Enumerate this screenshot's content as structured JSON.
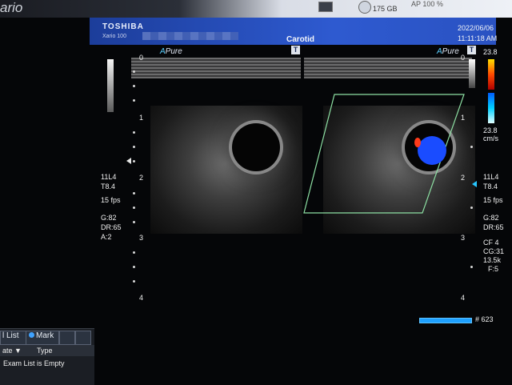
{
  "window": {
    "title_fragment": "ario"
  },
  "top_status": {
    "drive_label": "175 GB",
    "right_text": "AP 100 %"
  },
  "header": {
    "brand": "TOSHIBA",
    "model": "Xario 100",
    "preset": "Carotid",
    "date": "2022/06/06",
    "time": "11:11:18 AM"
  },
  "modes": {
    "left_pure": "Pure",
    "right_pure": "Pure",
    "freeze_icon_label": "T"
  },
  "left_params": {
    "probe": "11L4",
    "freq": "T8.4",
    "fps": "15 fps",
    "gain": "G:82",
    "dr": "DR:65",
    "a": "A:2"
  },
  "right_params": {
    "probe": "11L4",
    "freq": "T8.4",
    "fps": "15 fps",
    "gain": "G:82",
    "dr": "DR:65",
    "cf": "CF 4",
    "cg": "CG:31",
    "prf": "13.5k",
    "f": "F:5"
  },
  "color_scale": {
    "top": "23.8",
    "bottom": "23.8",
    "unit": "cm/s"
  },
  "depth_marks": [
    "0",
    "1",
    "2",
    "3",
    "4"
  ],
  "frame": {
    "number": "# 623"
  },
  "exam_panel": {
    "tab_list": "l List",
    "tab_mark": "Mark",
    "col_date": "ate",
    "col_type": "Type",
    "empty_text": "Exam List is Empty"
  },
  "colors": {
    "header_blue": "#2e5ad0",
    "roi_green": "#8de0a3",
    "flow_blue": "#1a4cff",
    "flow_red": "#ff3a1a"
  }
}
